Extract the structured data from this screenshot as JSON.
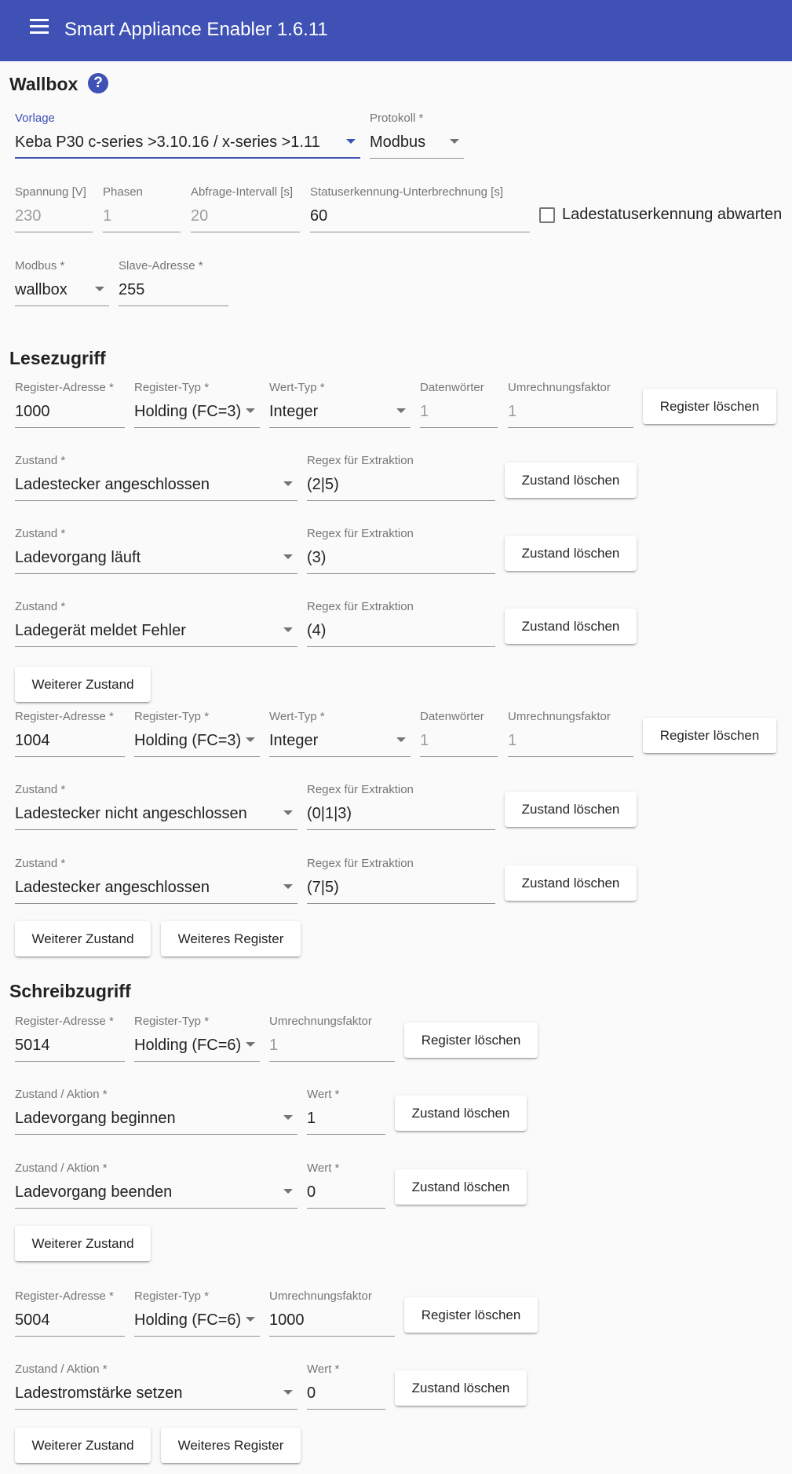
{
  "app": {
    "title": "Smart Appliance Enabler 1.6.11",
    "menu_icon": "menu-icon"
  },
  "page": {
    "title": "Wallbox",
    "help_icon": "help-icon",
    "help_glyph": "?"
  },
  "colors": {
    "primary": "#3f51b5",
    "background": "#fafafa"
  },
  "general": {
    "vorlage": {
      "label": "Vorlage",
      "value": "Keba P30 c-series >3.10.16 / x-series >1.11"
    },
    "protokoll": {
      "label": "Protokoll *",
      "value": "Modbus"
    },
    "spannung": {
      "label": "Spannung [V]",
      "placeholder": "230"
    },
    "phasen": {
      "label": "Phasen",
      "placeholder": "1"
    },
    "abfrage": {
      "label": "Abfrage-Intervall [s]",
      "placeholder": "20"
    },
    "status_unterbrechung": {
      "label": "Statuserkennung-Unterbrechnung [s]",
      "value": "60"
    },
    "ladestatus_checkbox": {
      "label": "Ladestatuserkennung abwarten",
      "checked": false
    },
    "modbus": {
      "label": "Modbus *",
      "value": "wallbox"
    },
    "slave": {
      "label": "Slave-Adresse *",
      "value": "255"
    }
  },
  "read": {
    "title": "Lesezugriff",
    "registers": [
      {
        "address_label": "Register-Adresse *",
        "address": "1000",
        "type_label": "Register-Typ *",
        "type": "Holding (FC=3)",
        "valuetype_label": "Wert-Typ *",
        "valuetype": "Integer",
        "words_label": "Datenwörter",
        "words_placeholder": "1",
        "factor_label": "Umrechnungsfaktor",
        "factor_placeholder": "1",
        "delete_label": "Register löschen",
        "states": [
          {
            "label": "Zustand *",
            "value": "Ladestecker angeschlossen",
            "regex_label": "Regex für Extraktion",
            "regex": "(2|5)",
            "delete_label": "Zustand löschen"
          },
          {
            "label": "Zustand *",
            "value": "Ladevorgang läuft",
            "regex_label": "Regex für Extraktion",
            "regex": "(3)",
            "delete_label": "Zustand löschen"
          },
          {
            "label": "Zustand *",
            "value": "Ladegerät meldet Fehler",
            "regex_label": "Regex für Extraktion",
            "regex": "(4)",
            "delete_label": "Zustand löschen"
          }
        ],
        "add_state_label": "Weiterer Zustand"
      },
      {
        "address_label": "Register-Adresse *",
        "address": "1004",
        "type_label": "Register-Typ *",
        "type": "Holding (FC=3)",
        "valuetype_label": "Wert-Typ *",
        "valuetype": "Integer",
        "words_label": "Datenwörter",
        "words_placeholder": "1",
        "factor_label": "Umrechnungsfaktor",
        "factor_placeholder": "1",
        "delete_label": "Register löschen",
        "states": [
          {
            "label": "Zustand *",
            "value": "Ladestecker nicht angeschlossen",
            "regex_label": "Regex für Extraktion",
            "regex": "(0|1|3)",
            "delete_label": "Zustand löschen"
          },
          {
            "label": "Zustand *",
            "value": "Ladestecker angeschlossen",
            "regex_label": "Regex für Extraktion",
            "regex": "(7|5)",
            "delete_label": "Zustand löschen"
          }
        ],
        "add_state_label": "Weiterer Zustand",
        "add_register_label": "Weiteres Register"
      }
    ]
  },
  "write": {
    "title": "Schreibzugriff",
    "registers": [
      {
        "address_label": "Register-Adresse *",
        "address": "5014",
        "type_label": "Register-Typ *",
        "type": "Holding (FC=6)",
        "factor_label": "Umrechnungsfaktor",
        "factor_placeholder": "1",
        "factor": "",
        "delete_label": "Register löschen",
        "states": [
          {
            "label": "Zustand / Aktion *",
            "value": "Ladevorgang beginnen",
            "wert_label": "Wert *",
            "wert": "1",
            "delete_label": "Zustand löschen"
          },
          {
            "label": "Zustand / Aktion *",
            "value": "Ladevorgang beenden",
            "wert_label": "Wert *",
            "wert": "0",
            "delete_label": "Zustand löschen"
          }
        ],
        "add_state_label": "Weiterer Zustand"
      },
      {
        "address_label": "Register-Adresse *",
        "address": "5004",
        "type_label": "Register-Typ *",
        "type": "Holding (FC=6)",
        "factor_label": "Umrechnungsfaktor",
        "factor": "1000",
        "delete_label": "Register löschen",
        "states": [
          {
            "label": "Zustand / Aktion *",
            "value": "Ladestromstärke setzen",
            "wert_label": "Wert *",
            "wert": "0",
            "delete_label": "Zustand löschen"
          }
        ],
        "add_state_label": "Weiterer Zustand",
        "add_register_label": "Weiteres Register"
      }
    ]
  }
}
